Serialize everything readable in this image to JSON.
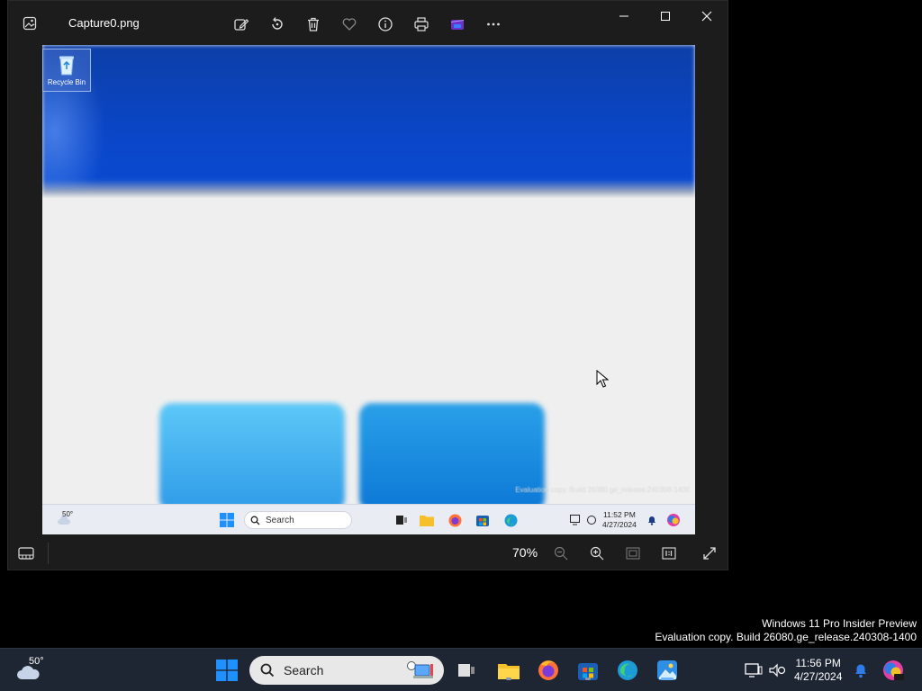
{
  "window": {
    "title": "Capture0.png",
    "zoom": "70%",
    "toolbar": [
      "edit-image",
      "rotate",
      "delete",
      "favorite",
      "file-info",
      "print",
      "clipchamp",
      "more"
    ]
  },
  "captured_image": {
    "recycle_bin_label": "Recycle Bin",
    "watermark_small": "Evaluation copy. Build 26080.ge_release.240308-1400",
    "taskbar": {
      "temperature": "50°",
      "search_label": "Search",
      "time": "11:52 PM",
      "date": "4/27/2024"
    }
  },
  "desktop": {
    "watermark_line1": "Windows 11 Pro Insider Preview",
    "watermark_line2": "Evaluation copy. Build 26080.ge_release.240308-1400"
  },
  "taskbar": {
    "temperature": "50°",
    "search_label": "Search",
    "time": "11:56 PM",
    "date": "4/27/2024"
  },
  "colors": {
    "accent": "#0a4ad0",
    "taskbar_bg": "#1f2633",
    "window_bg": "#1c1c1c"
  }
}
